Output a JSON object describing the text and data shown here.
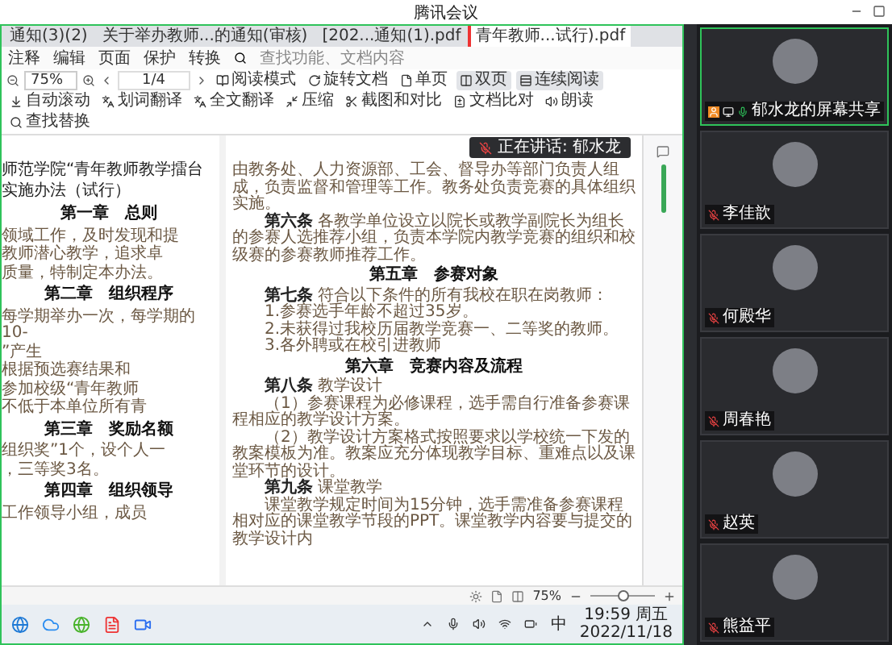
{
  "window": {
    "title": "腾讯会议"
  },
  "browser_tabs": [
    {
      "label": "通知(3)(2)",
      "selected": false
    },
    {
      "label": "关于举办教师...的通知(审核)",
      "selected": false
    },
    {
      "label": "[202...通知(1).pdf",
      "selected": false
    },
    {
      "label": "青年教师...试行).pdf",
      "selected": true
    }
  ],
  "menu": [
    "注释",
    "编辑",
    "页面",
    "保护",
    "转换"
  ],
  "search": {
    "placeholder": "查找功能、文档内容"
  },
  "toolbar": {
    "zoom": "75%",
    "page": "1/4",
    "items": [
      {
        "label": "阅读模式",
        "selected": false
      },
      {
        "label": "旋转文档",
        "selected": false
      },
      {
        "label": "单页",
        "selected": false
      },
      {
        "label": "双页",
        "selected": true
      },
      {
        "label": "连续阅读",
        "selected": true
      },
      {
        "label": "自动滚动",
        "selected": false
      },
      {
        "label": "划词翻译",
        "selected": false
      },
      {
        "label": "全文翻译",
        "selected": false
      },
      {
        "label": "压缩",
        "selected": false
      },
      {
        "label": "截图和对比",
        "selected": false
      },
      {
        "label": "文档比对",
        "selected": false
      },
      {
        "label": "朗读",
        "selected": false
      },
      {
        "label": "查找替换",
        "selected": false
      }
    ]
  },
  "speaking_badge": {
    "label": "正在讲话: 郁水龙"
  },
  "document": {
    "left_page": [
      {
        "kind": "title",
        "text": "师范学院“青年教师教学擂台"
      },
      {
        "kind": "title",
        "text": "实施办法（试行）"
      },
      {
        "kind": "heading",
        "text": "第一章　总则"
      },
      {
        "kind": "body",
        "text": "领域工作，及时发现和提"
      },
      {
        "kind": "body",
        "text": "教师潜心教学，追求卓"
      },
      {
        "kind": "body",
        "text": "质量，特制定本办法。"
      },
      {
        "kind": "heading",
        "text": "第二章　组织程序"
      },
      {
        "kind": "body",
        "text": "每学期举办一次，每学期的10-"
      },
      {
        "kind": "body",
        "text": "”产生"
      },
      {
        "kind": "body",
        "text": "根据预选赛结果和"
      },
      {
        "kind": "body",
        "text": "参加校级“青年教师"
      },
      {
        "kind": "body",
        "text": "不低于本单位所有青"
      },
      {
        "kind": "heading",
        "text": "第三章　奖励名额"
      },
      {
        "kind": "body",
        "text": "组织奖”1个，设个人一"
      },
      {
        "kind": "body",
        "text": "，三等奖3名。"
      },
      {
        "kind": "heading",
        "text": "第四章　组织领导"
      },
      {
        "kind": "body",
        "text": "工作领导小组，成员"
      }
    ],
    "right_page": [
      {
        "kind": "body",
        "text": "由教务处、人力资源部、工会、督导办等部门负责人组成，负责监督和管理等工作。教务处负责竞赛的具体组织实施。"
      },
      {
        "kind": "article",
        "text": "**第六条** 各教学单位设立以院长或教学副院长为组长的参赛人选推荐小组，负责本学院内教学竞赛的组织和校级赛的参赛教师推荐工作。"
      },
      {
        "kind": "heading",
        "text": "第五章　参赛对象"
      },
      {
        "kind": "article",
        "text": "**第七条** 符合以下条件的所有我校在职在岗教师："
      },
      {
        "kind": "article",
        "text": "1.参赛选手年龄不超过35岁。"
      },
      {
        "kind": "article",
        "text": "2.未获得过我校历届教学竞赛一、二等奖的教师。"
      },
      {
        "kind": "article",
        "text": "3.各外聘或在校引进教师"
      },
      {
        "kind": "heading",
        "text": "第六章　竞赛内容及流程"
      },
      {
        "kind": "article",
        "text": "**第八条** 教学设计"
      },
      {
        "kind": "article",
        "text": "（1）参赛课程为必修课程，选手需自行准备参赛课程相应的教学设计方案。"
      },
      {
        "kind": "article",
        "text": "（2）教学设计方案格式按照要求以学校统一下发的教案模板为准。教案应充分体现教学目标、重难点以及课堂环节的设计。"
      },
      {
        "kind": "article",
        "text": "**第九条** 课堂教学"
      },
      {
        "kind": "article",
        "text": "课堂教学规定时间为15分钟，选手需准备参赛课程相对应的课堂教学节段的PPT。课堂教学内容要与提交的教学设计内"
      }
    ]
  },
  "status_bar": {
    "zoom": "75%",
    "zoom_slider": {
      "level": 0.5
    }
  },
  "taskbar": {
    "ime": "中",
    "time": "19:59 周五",
    "date": "2022/11/18"
  },
  "participants": [
    {
      "name": "郁水龙的屏幕共享",
      "kind": "screen_share",
      "muted": false,
      "speaking": true
    },
    {
      "name": "李佳歆",
      "kind": "camera",
      "muted": true,
      "speaking": false
    },
    {
      "name": "何殿华",
      "kind": "camera",
      "muted": true,
      "speaking": false
    },
    {
      "name": "周春艳",
      "kind": "camera",
      "muted": true,
      "speaking": false
    },
    {
      "name": "赵英",
      "kind": "camera",
      "muted": true,
      "speaking": false
    },
    {
      "name": "熊益平",
      "kind": "camera",
      "muted": true,
      "speaking": false
    }
  ]
}
